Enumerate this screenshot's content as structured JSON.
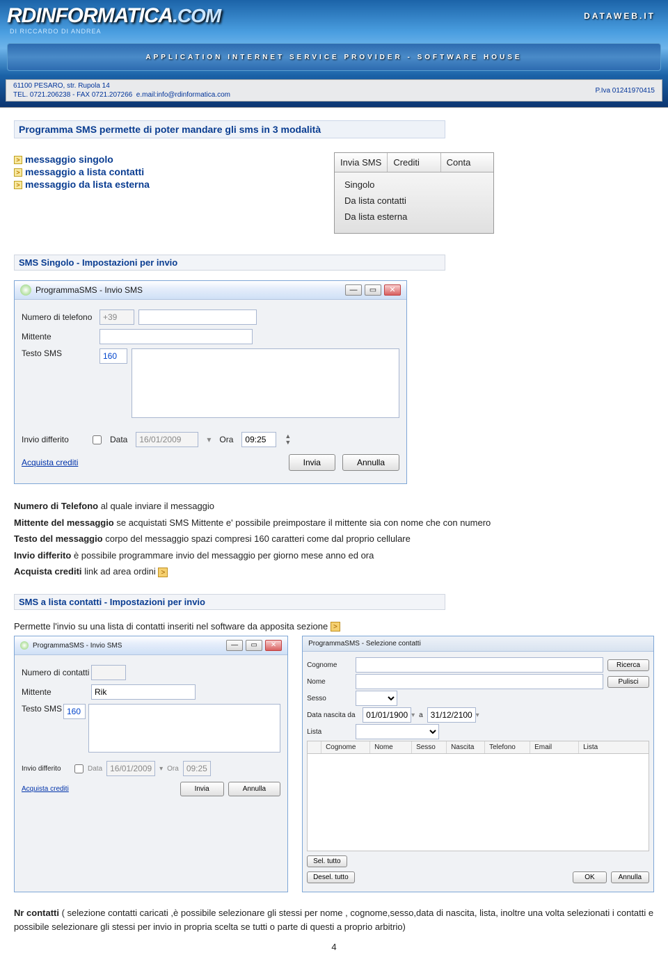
{
  "banner": {
    "logo_main": "RDINFORMATICA",
    "logo_com": ".COM",
    "logo_sub": "DI RICCARDO DI ANDREA",
    "dataweb": "DATAWEB.IT",
    "tagline": "APPLICATION INTERNET SERVICE PROVIDER - SOFTWARE HOUSE",
    "address": "61100 PESARO, str. Rupola 14",
    "contacts": "TEL. 0721.206238 - FAX 0721.207266  e.mail:info@rdinformatica.com",
    "piva": "P.Iva 01241970415"
  },
  "headings": {
    "h1": "Programma SMS permette di poter mandare gli sms in 3 modalità",
    "h2": "SMS Singolo - Impostazioni per invio",
    "h3": "SMS a lista contatti - Impostazioni per invio"
  },
  "bullets": {
    "b1": "messaggio singolo",
    "b2": "messaggio a lista contatti",
    "b3": "messaggio da lista esterna"
  },
  "menu": {
    "tab1": "Invia SMS",
    "tab2": "Crediti",
    "tab3": "Conta",
    "items": {
      "m1": "Singolo",
      "m2": "Da lista contatti",
      "m3": "Da lista esterna"
    }
  },
  "win1": {
    "title": "ProgrammaSMS - Invio SMS",
    "lbl_phone": "Numero di telefono",
    "val_prefix": "+39",
    "lbl_mittente": "Mittente",
    "lbl_testo": "Testo SMS",
    "val_charcount": "160",
    "lbl_differito": "Invio differito",
    "lbl_data": "Data",
    "val_data": "16/01/2009",
    "lbl_ora": "Ora",
    "val_ora": "09:25",
    "link_acquista": "Acquista crediti",
    "btn_invia": "Invia",
    "btn_annulla": "Annulla"
  },
  "descr1": {
    "phone_b": "Numero di Telefono",
    "phone_t": " al quale inviare il messaggio",
    "mitt_b": "Mittente del messaggio",
    "mitt_t": " se acquistati SMS Mittente e' possibile preimpostare il mittente sia con nome che con numero",
    "testo_b": "Testo del messaggio",
    "testo_t": " corpo del messaggio spazi compresi 160 caratteri come dal proprio cellulare",
    "diff_b": "Invio differito",
    "diff_t": " è possibile programmare invio del messaggio per giorno mese anno ed ora",
    "acq_b": "Acquista crediti",
    "acq_t": " link ad area ordini"
  },
  "descr2": {
    "line": "Permette l'invio su una lista di contatti inseriti nel software da apposita sezione"
  },
  "win2": {
    "title": "ProgrammaSMS - Invio SMS",
    "lbl_ncontatti": "Numero di contatti",
    "lbl_mittente": "Mittente",
    "val_mittente": "Rik",
    "lbl_testo": "Testo SMS",
    "val_charcount": "160",
    "lbl_differito": "Invio differito",
    "lbl_data": "Data",
    "val_data": "16/01/2009",
    "lbl_ora": "Ora",
    "val_ora": "09:25",
    "link_acquista": "Acquista crediti",
    "btn_invia": "Invia",
    "btn_annulla": "Annulla"
  },
  "win3": {
    "title": "ProgrammaSMS - Selezione contatti",
    "lbl_cognome": "Cognome",
    "lbl_nome": "Nome",
    "lbl_sesso": "Sesso",
    "lbl_datada": "Data nascita da",
    "val_da": "01/01/1900",
    "lbl_a": "a",
    "val_a": "31/12/2100",
    "lbl_lista": "Lista",
    "btn_ricerca": "Ricerca",
    "btn_pulisci": "Pulisci",
    "cols": {
      "c1": "Cognome",
      "c2": "Nome",
      "c3": "Sesso",
      "c4": "Nascita",
      "c5": "Telefono",
      "c6": "Email",
      "c7": "Lista"
    },
    "btn_seltutto": "Sel. tutto",
    "btn_deseltutto": "Desel. tutto",
    "btn_ok": "OK",
    "btn_annulla": "Annulla"
  },
  "footer": {
    "nr_b": "Nr contatti",
    "nr_t": " ( selezione contatti caricati ,è possibile selezionare gli stessi per nome , cognome,sesso,data di nascita, lista, inoltre una volta selezionati i contatti e possibile selezionare gli stessi per invio in propria scelta se tutti o parte di questi a proprio arbitrio)",
    "page": "4"
  }
}
